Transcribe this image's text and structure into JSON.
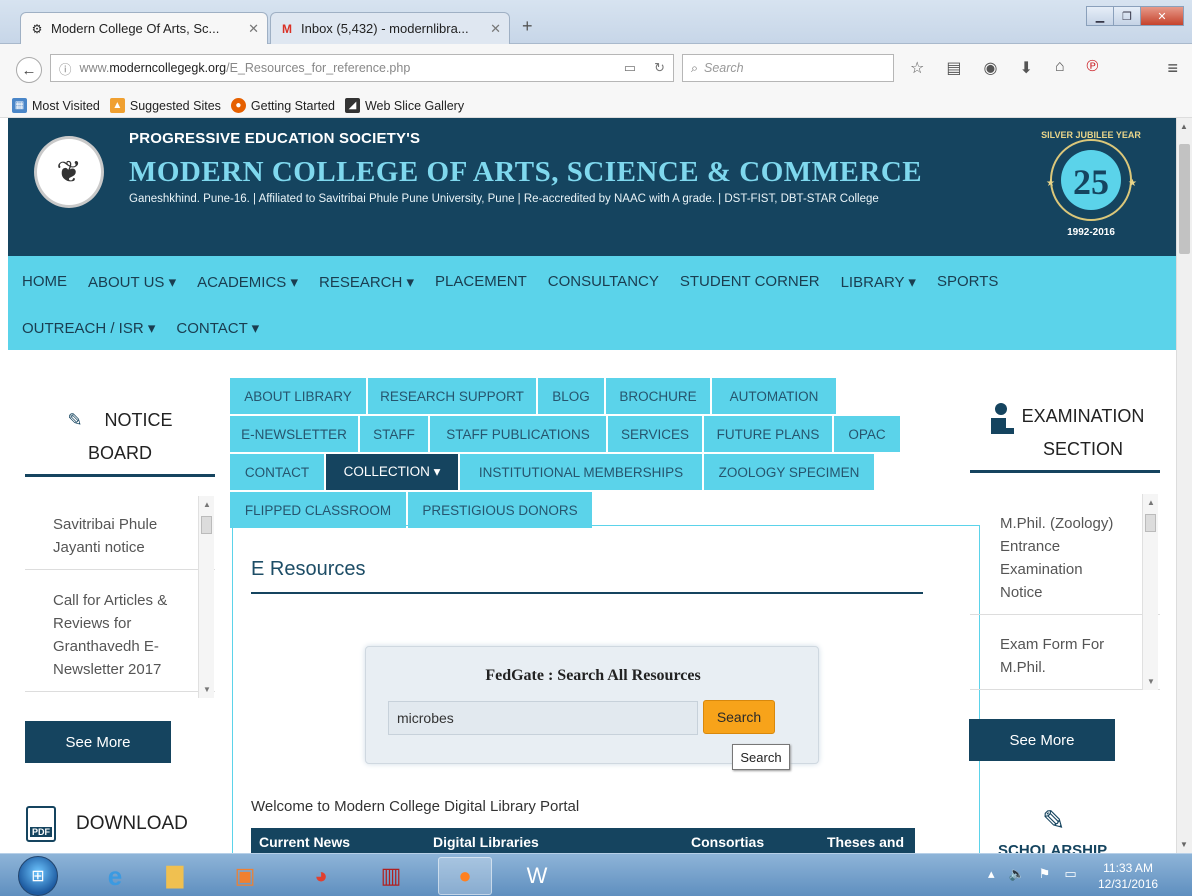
{
  "browser": {
    "tabs": [
      {
        "title": "Modern College Of Arts, Sc...",
        "icon": "site-favicon",
        "active": true
      },
      {
        "title": "Inbox (5,432) - modernlibra...",
        "icon": "gmail-icon",
        "active": false
      }
    ],
    "url_prefix": "www.",
    "url_host": "moderncollegegk.org",
    "url_path": "/E_Resources_for_reference.php",
    "search_placeholder": "Search",
    "bookmarks": [
      "Most Visited",
      "Suggested Sites",
      "Getting Started",
      "Web Slice Gallery"
    ]
  },
  "header": {
    "society": "PROGRESSIVE EDUCATION SOCIETY'S",
    "college": "MODERN COLLEGE OF ARTS, SCIENCE & COMMERCE",
    "tagline": "Ganeshkhind. Pune-16.   |   Affiliated to Savitribai Phule Pune University, Pune   |   Re-accredited by NAAC with A grade.   |   DST-FIST, DBT-STAR College",
    "badge_top": "SILVER JUBILEE YEAR",
    "badge_number": "25",
    "badge_years": "1992-2016"
  },
  "main_nav": {
    "row1": [
      "HOME",
      "ABOUT US ▾",
      "ACADEMICS ▾",
      "RESEARCH ▾",
      "PLACEMENT",
      "CONSULTANCY",
      "STUDENT CORNER",
      "LIBRARY ▾",
      "SPORTS"
    ],
    "row2": [
      "OUTREACH / ISR ▾",
      "CONTACT ▾"
    ]
  },
  "notice_board": {
    "heading_1": "NOTICE",
    "heading_2": "BOARD",
    "items": [
      "Savitribai Phule Jayanti notice",
      "Call for Articles & Reviews for Granthavedh E-Newsletter 2017"
    ],
    "see_more": "See More"
  },
  "download": {
    "heading": "DOWNLOAD",
    "pdf_label": "PDF"
  },
  "library_tabs": {
    "row1": [
      "ABOUT LIBRARY",
      "RESEARCH SUPPORT",
      "BLOG",
      "BROCHURE",
      "AUTOMATION"
    ],
    "row2": [
      "E-NEWSLETTER",
      "STAFF",
      "STAFF PUBLICATIONS",
      "SERVICES",
      "FUTURE PLANS",
      "OPAC"
    ],
    "row3": [
      "CONTACT",
      "COLLECTION ▾",
      "INSTITUTIONAL MEMBERSHIPS",
      "ZOOLOGY SPECIMEN"
    ],
    "row4": [
      "FLIPPED CLASSROOM",
      "PRESTIGIOUS DONORS"
    ]
  },
  "content": {
    "title": "E Resources",
    "fedgate_title": "FedGate : Search All Resources",
    "search_value": "microbes",
    "search_button": "Search",
    "tooltip": "Search",
    "welcome": "Welcome to Modern College Digital Library Portal",
    "table_headers": [
      "Current News",
      "Digital Libraries",
      "Consortias",
      "Theses and"
    ]
  },
  "exam_section": {
    "heading_1": "EXAMINATION",
    "heading_2": "SECTION",
    "items": [
      "M.Phil. (Zoology) Entrance Examination Notice",
      "Exam Form For M.Phil."
    ],
    "see_more": "See More"
  },
  "scholarship": {
    "heading": "SCHOLARSHIP"
  },
  "taskbar": {
    "time": "11:33 AM",
    "date": "12/31/2016",
    "apps": [
      "internet-explorer-icon",
      "file-explorer-icon",
      "media-player-icon",
      "chrome-icon",
      "library-app-icon",
      "firefox-icon",
      "word-icon"
    ]
  },
  "colors": {
    "navy": "#15445f",
    "cyan": "#5bd3ea",
    "orange": "#f7a31a"
  }
}
